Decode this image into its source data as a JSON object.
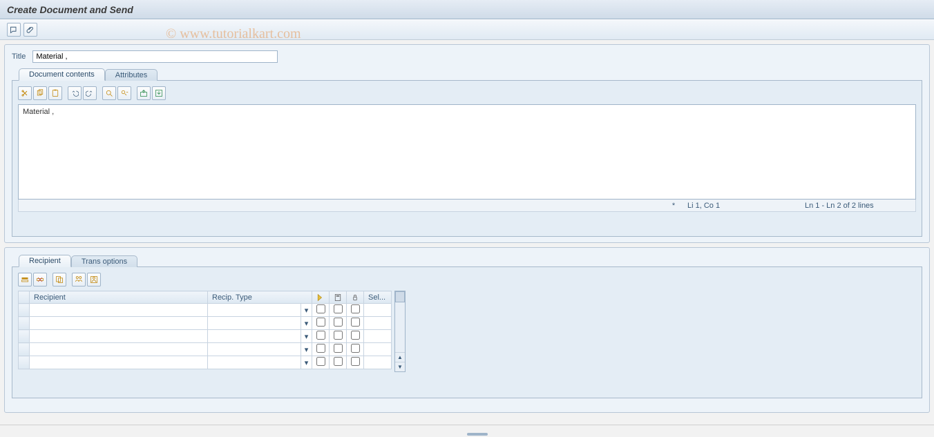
{
  "watermark": "© www.tutorialkart.com",
  "header": {
    "title": "Create Document and Send"
  },
  "titleField": {
    "label": "Title",
    "value": "Material ,"
  },
  "tabsTop": {
    "items": [
      {
        "label": "Document contents",
        "active": true
      },
      {
        "label": "Attributes",
        "active": false
      }
    ]
  },
  "editor": {
    "content": "Material ,"
  },
  "statusBar": {
    "modified": "*",
    "pos": "Li 1, Co 1",
    "lines": "Ln 1 - Ln 2 of 2 lines"
  },
  "tabsBottom": {
    "items": [
      {
        "label": "Recipient",
        "active": true
      },
      {
        "label": "Trans options",
        "active": false
      }
    ]
  },
  "recipientTable": {
    "headers": {
      "recipient": "Recipient",
      "type": "Recip. Type",
      "sel": "Sel..."
    },
    "rows": [
      {
        "recipient": "",
        "type": "",
        "c1": false,
        "c2": false,
        "c3": false
      },
      {
        "recipient": "",
        "type": "",
        "c1": false,
        "c2": false,
        "c3": false
      },
      {
        "recipient": "",
        "type": "",
        "c1": false,
        "c2": false,
        "c3": false
      },
      {
        "recipient": "",
        "type": "",
        "c1": false,
        "c2": false,
        "c3": false
      },
      {
        "recipient": "",
        "type": "",
        "c1": false,
        "c2": false,
        "c3": false
      }
    ]
  }
}
